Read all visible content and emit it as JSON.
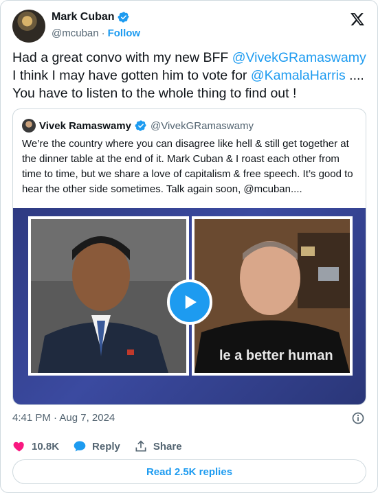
{
  "author": {
    "name": "Mark Cuban",
    "handle": "@mcuban",
    "separator": "·",
    "follow_label": "Follow"
  },
  "tweet": {
    "line1_prefix": "Had a great convo with my new BFF ",
    "line1_mention": "@VivekGRamaswamy",
    "line2_prefix": "I think I may have gotten him to vote for ",
    "line2_mention": "@KamalaHarris",
    "line2_suffix": " ....",
    "line3": "You have to listen to the whole thing to find out !"
  },
  "quote": {
    "name": "Vivek Ramaswamy",
    "handle": "@VivekGRamaswamy",
    "text": "We’re the country where you can disagree like hell & still get together at the dinner table at the end of it. Mark Cuban & I roast each other from time to time, but we share a love of capitalism & free speech. It’s good to hear the other side sometimes. Talk again soon, @mcuban...."
  },
  "media": {
    "shirt_text": "le a better human"
  },
  "meta": {
    "timestamp": "4:41 PM · Aug 7, 2024"
  },
  "actions": {
    "like_count": "10.8K",
    "reply_label": "Reply",
    "share_label": "Share"
  },
  "read_replies_label": "Read 2.5K replies",
  "icons": {
    "verified": "verified-badge-icon",
    "x_logo": "x-logo-icon",
    "play": "play-icon",
    "info": "info-icon",
    "heart": "heart-icon",
    "reply": "reply-bubble-icon",
    "share": "share-icon"
  },
  "colors": {
    "accent": "#1d9bf0",
    "like": "#f91880",
    "muted": "#536471",
    "border": "#cfd9de"
  }
}
